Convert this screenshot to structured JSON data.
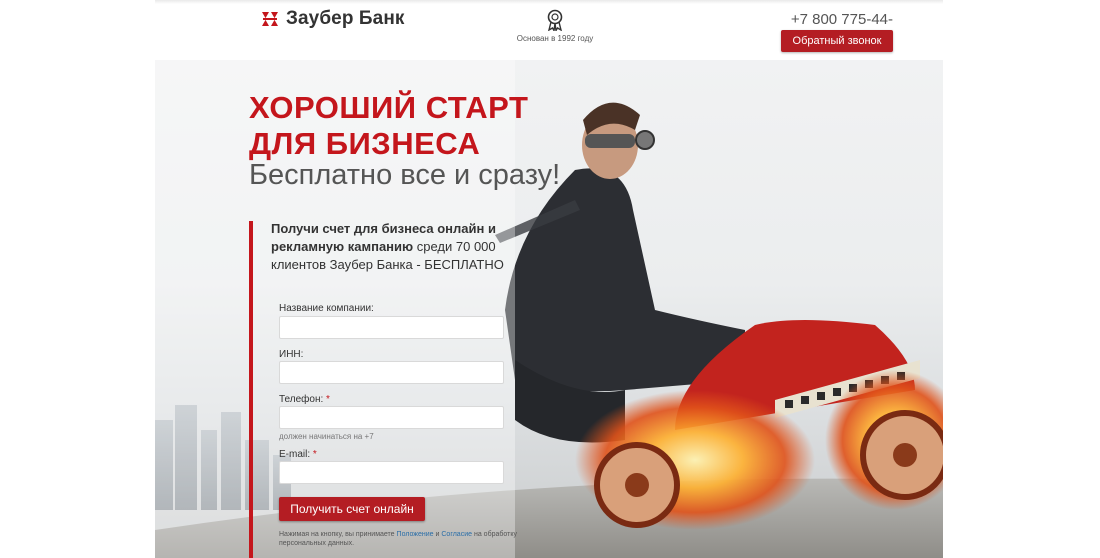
{
  "header": {
    "brand": "Заубер Банк",
    "award_caption": "Основан в 1992 году",
    "phone": "+7 800 775-44-54",
    "callback_label": "Обратный звонок"
  },
  "hero": {
    "headline_line1": "ХОРОШИЙ СТАРТ",
    "headline_line2": "ДЛЯ БИЗНЕСА",
    "subheadline": "Бесплатно все и сразу!",
    "offer_bold": "Получи счет для бизнеса онлайн и рекламную кампанию",
    "offer_rest": "среди 70 000 клиентов Заубер Банка - БЕСПЛАТНО"
  },
  "form": {
    "company_label": "Название компании:",
    "inn_label": "ИНН:",
    "phone_label": "Телефон:",
    "phone_hint": "должен начинаться на +7",
    "email_label": "E-mail:",
    "required_mark": "*",
    "submit_label": "Получить счет онлайн",
    "consent_prefix": "Нажимая на кнопку, вы принимаете",
    "consent_link1": "Положение",
    "consent_and": "и",
    "consent_link2": "Согласие",
    "consent_suffix": "на обработку персональных данных."
  },
  "colors": {
    "brand_red": "#c4161c",
    "button_red": "#b41d23"
  },
  "icons": {
    "logo": "zauber-logo-icon",
    "award": "award-ribbon-icon"
  }
}
